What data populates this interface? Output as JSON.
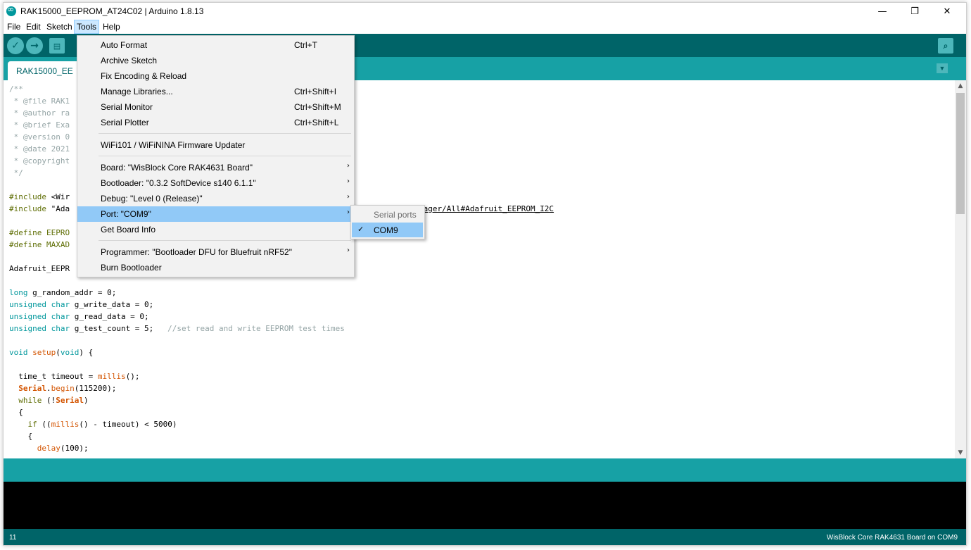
{
  "window": {
    "title": "RAK15000_EEPROM_AT24C02 | Arduino 1.8.13",
    "controls": {
      "minimize": "—",
      "maximize": "❐",
      "close": "✕"
    }
  },
  "menubar": [
    "File",
    "Edit",
    "Sketch",
    "Tools",
    "Help"
  ],
  "toolbar": {
    "verify_icon": "check-icon",
    "upload_icon": "arrow-right-icon",
    "new_icon": "document-icon",
    "serial_monitor_icon": "magnifier-icon"
  },
  "tab": {
    "label": "RAK15000_EE"
  },
  "code_lines": {
    "l1": "/**",
    "l2": " * @file RAK1",
    "l3": " * @author ra",
    "l4": " * @brief Exa",
    "l5": " * @version 0",
    "l6": " * @date 2021",
    "l7": " * @copyright",
    "l8": " */",
    "inc1_a": "#include ",
    "inc1_b": "<Wir",
    "inc2_a": "#include ",
    "inc2_b": "\"Ada",
    "inc2_url": "nager/All#Adafruit_EEPROM_I2C",
    "def1": "#define EEPRO",
    "def2": "#define MAXAD",
    "obj": "Adafruit_EEPR",
    "v1_kw": "long",
    "v1_rest": " g_random_addr = 0;",
    "v2_kw": "unsigned char",
    "v2_rest": " g_write_data = 0;",
    "v3_kw": "unsigned char",
    "v3_rest": " g_read_data = 0;",
    "v4_kw": "unsigned char",
    "v4_rest": " g_test_count = 5;   ",
    "v4_cm": "//set read and write EEPROM test times",
    "setup_kw": "void",
    "setup_fn": " setup",
    "setup_p1": "(",
    "setup_arg": "void",
    "setup_p2": ") {",
    "t1": "  time_t timeout = ",
    "t1_fn": "millis",
    "t1_end": "();",
    "s1_obj": "  Serial",
    "s1_dot": ".",
    "s1_fn": "begin",
    "s1_end": "(115200);",
    "w1_kw": "  while",
    "w1_mid": " (!",
    "w1_obj": "Serial",
    "w1_end": ")",
    "b1": "  {",
    "if_kw": "    if",
    "if_mid": " ((",
    "if_fn": "millis",
    "if_end": "() - timeout) < 5000)",
    "b2": "    {",
    "d_fn": "      delay",
    "d_end": "(100);"
  },
  "tools_menu": {
    "auto_format": {
      "label": "Auto Format",
      "shortcut": "Ctrl+T"
    },
    "archive_sketch": {
      "label": "Archive Sketch"
    },
    "fix_encoding": {
      "label": "Fix Encoding & Reload"
    },
    "manage_libraries": {
      "label": "Manage Libraries...",
      "shortcut": "Ctrl+Shift+I"
    },
    "serial_monitor": {
      "label": "Serial Monitor",
      "shortcut": "Ctrl+Shift+M"
    },
    "serial_plotter": {
      "label": "Serial Plotter",
      "shortcut": "Ctrl+Shift+L"
    },
    "firmware_updater": {
      "label": "WiFi101 / WiFiNINA Firmware Updater"
    },
    "board": {
      "label": "Board: \"WisBlock Core RAK4631 Board\""
    },
    "bootloader": {
      "label": "Bootloader: \"0.3.2 SoftDevice s140 6.1.1\""
    },
    "debug": {
      "label": "Debug: \"Level 0 (Release)\""
    },
    "port": {
      "label": "Port: \"COM9\""
    },
    "board_info": {
      "label": "Get Board Info"
    },
    "programmer": {
      "label": "Programmer: \"Bootloader DFU for Bluefruit nRF52\""
    },
    "burn_bootloader": {
      "label": "Burn Bootloader"
    }
  },
  "port_submenu": {
    "header": "Serial ports",
    "item": "COM9",
    "check": "✓"
  },
  "status": {
    "line_number": "11",
    "board_port": "WisBlock Core RAK4631 Board on COM9"
  },
  "colors": {
    "toolbar": "#006468",
    "tabs_bar": "#17a1a5",
    "menu_highlight": "#91c9f7",
    "keyword": "#00979c",
    "function": "#d35400",
    "comment": "#95a5a6"
  }
}
